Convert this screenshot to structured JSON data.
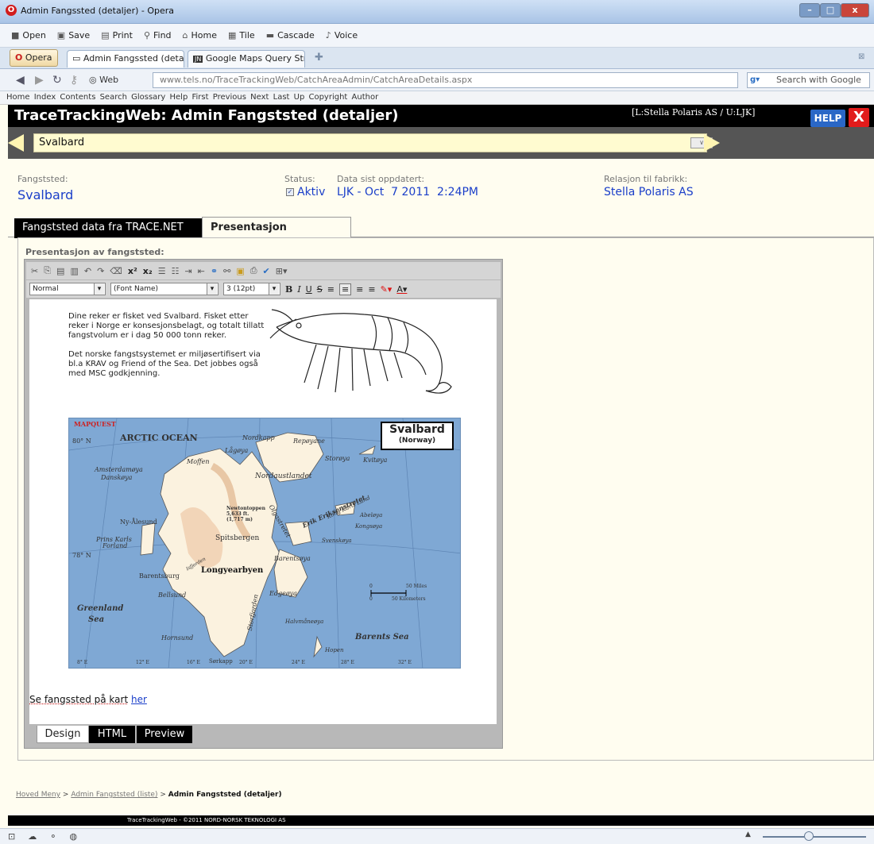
{
  "window": {
    "title": "Admin Fangssted (detaljer) - Opera"
  },
  "menu": {
    "items": [
      "Open",
      "Save",
      "Print",
      "Find",
      "Home",
      "Tile",
      "Cascade",
      "Voice"
    ]
  },
  "browser_tabs": {
    "opera_label": "Opera",
    "tabs": [
      {
        "label": "Admin Fangssted (deta..."
      },
      {
        "label": "Google Maps Query Str..."
      }
    ]
  },
  "address": {
    "web_label": "Web",
    "url": "www.tels.no/TraceTrackingWeb/CatchAreaAdmin/CatchAreaDetails.aspx",
    "search_placeholder": "Search with Google"
  },
  "links": {
    "text": "Home Index Contents Search Glossary Help First Previous Next Last Up Copyright Author"
  },
  "app": {
    "title": "TraceTrackingWeb: Admin Fangststed (detaljer)",
    "user": "[L:Stella Polaris AS / U:LJK]",
    "help": "HELP",
    "close": "X"
  },
  "selector": {
    "value": "Svalbard"
  },
  "info": {
    "fangststed_label": "Fangststed:",
    "fangststed_value": "Svalbard",
    "status_label": "Status:",
    "status_value": "Aktiv",
    "updated_label": "Data sist oppdatert:",
    "updated_value": "LJK - Oct  7 2011  2:24PM",
    "relation_label": "Relasjon til fabrikk:",
    "relation_value": "Stella Polaris AS"
  },
  "page_tabs": {
    "tab1": "Fangststed data fra TRACE.NET",
    "tab2": "Presentasjon fangststed"
  },
  "editor": {
    "label": "Presentasjon av fangststed:",
    "style": "Normal",
    "font": "(Font Name)",
    "size": "3 (12pt)",
    "p1": "Dine reker er fisket ved Svalbard. Fisket etter reker i Norge er konsesjonsbelagt, og totalt tillatt fangstvolum er i dag 50 000 tonn reker.",
    "p2": "Det norske fangstsystemet er miljøsertifisert via bl.a KRAV og Friend of the Sea. Det jobbes også med MSC godkjenning.",
    "link_text": "Se fangssted på kart",
    "link": "her",
    "modes": [
      "Design",
      "HTML",
      "Preview"
    ]
  },
  "map": {
    "brand": "MAPQUEST",
    "title": "Svalbard",
    "subtitle": "(Norway)",
    "labels": {
      "ocean": "ARCTIC OCEAN",
      "lat80": "80° N",
      "lat78": "78° N",
      "nordkapp": "Nordkapp",
      "repayane": "Repøyane",
      "lagoya": "Lågøya",
      "storoya": "Storøya",
      "kvitoya": "Kvitøya",
      "moffen": "Moffen",
      "amsterdamoya": "Amsterdamøya",
      "danskoya": "Danskøya",
      "nordaustlandet": "Nordaustlandet",
      "newtontoppen": "Newtontoppen",
      "elev1": "5,633 ft.",
      "elev2": "(1,717 m)",
      "olgastretet": "Olgastretet",
      "erik": "Erik Eriksenstretet",
      "kongkarls": "Kong Karls Land",
      "abeloya": "Abeløya",
      "kongsoya": "Kongsøya",
      "svenskoya": "Svenskøya",
      "nyalesund": "Ny-Ålesund",
      "prinskarls": "Prins Karls",
      "forland": "Forland",
      "spitsbergen": "Spitsbergen",
      "barentsoya": "Barentsøya",
      "barentsburg": "Barentsburg",
      "longyearbyen": "Longyearbyen",
      "isfjorden": "Isfjorden",
      "bellsund": "Bellsund",
      "edgeoya": "Edgeøya",
      "storfjorden": "Storfjorden",
      "greenland": "Greenland",
      "sea": "Sea",
      "hornsund": "Hornsund",
      "halvmaneoya": "Halvmåneøya",
      "barentssea": "Barents Sea",
      "hopen": "Hopen",
      "sorkapp": "Sørkapp",
      "e8": "8° E",
      "e12": "12° E",
      "e16": "16° E",
      "e20": "20° E",
      "e24": "24° E",
      "e28": "28° E",
      "e32": "32° E",
      "s0": "0",
      "s50mi": "50 Miles",
      "s50km": "50 Kilometers"
    }
  },
  "breadcrumb": {
    "home": "Hoved Meny",
    "list": "Admin Fangststed (liste)",
    "current": "Admin Fangststed (detaljer)"
  },
  "footer": {
    "text": "TraceTrackingWeb - ©2011 NORD-NORSK TEKNOLOGI AS"
  }
}
